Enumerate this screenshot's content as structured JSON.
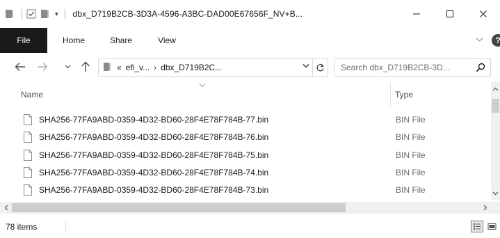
{
  "window": {
    "title": "dbx_D719B2CB-3D3A-4596-A3BC-DAD00E67656F_NV+B...",
    "minimize_label": "—",
    "maximize_label": "☐",
    "close_label": "✕"
  },
  "quick_access": {
    "dropdown_glyph": "▾"
  },
  "ribbon": {
    "tabs": [
      {
        "label": "File"
      },
      {
        "label": "Home"
      },
      {
        "label": "Share"
      },
      {
        "label": "View"
      }
    ],
    "collapse_glyph": "﹀",
    "help_glyph": "?"
  },
  "navigation": {
    "back_glyph": "←",
    "forward_glyph": "→",
    "recent_glyph": "⌄",
    "up_glyph": "↑"
  },
  "address": {
    "overflow_glyph": "«",
    "crumbs": [
      "efi_v...",
      "dbx_D719B2C..."
    ],
    "separator": "›",
    "dropdown_glyph": "⌄"
  },
  "search": {
    "placeholder": "Search dbx_D719B2CB-3D..."
  },
  "columns": {
    "name": "Name",
    "type": "Type",
    "sort_glyph": "⌄"
  },
  "files": [
    {
      "name": "SHA256-77FA9ABD-0359-4D32-BD60-28F4E78F784B-77.bin",
      "type": "BIN File"
    },
    {
      "name": "SHA256-77FA9ABD-0359-4D32-BD60-28F4E78F784B-76.bin",
      "type": "BIN File"
    },
    {
      "name": "SHA256-77FA9ABD-0359-4D32-BD60-28F4E78F784B-75.bin",
      "type": "BIN File"
    },
    {
      "name": "SHA256-77FA9ABD-0359-4D32-BD60-28F4E78F784B-74.bin",
      "type": "BIN File"
    },
    {
      "name": "SHA256-77FA9ABD-0359-4D32-BD60-28F4E78F784B-73.bin",
      "type": "BIN File"
    }
  ],
  "scrollbars": {
    "up_glyph": "▲",
    "down_glyph": "▼",
    "left_glyph": "◀",
    "right_glyph": "▶"
  },
  "status": {
    "item_count": "78 items"
  },
  "colors": {
    "file_tab_bg": "#1a1a1a",
    "folder_icon": "#8a8a8a",
    "text": "#1a1a1a",
    "muted_text": "#6d6d6d"
  }
}
